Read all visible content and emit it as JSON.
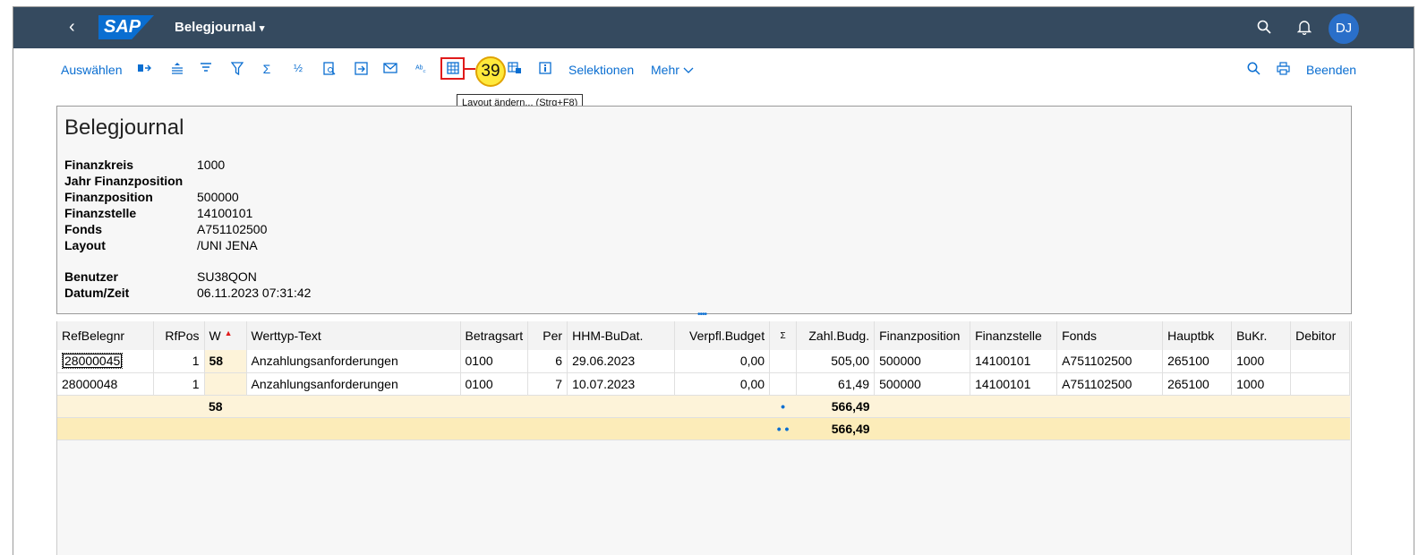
{
  "shell": {
    "title": "Belegjournal",
    "caret": "▾",
    "back_icon": "‹",
    "logo": "SAP",
    "avatar": "DJ"
  },
  "toolbar": {
    "auswaehlen": "Auswählen",
    "selektionen": "Selektionen",
    "mehr": "Mehr",
    "beenden": "Beenden",
    "step_number": "39",
    "tooltip": "Layout ändern... (Strg+F8)"
  },
  "header": {
    "title": "Belegjournal",
    "fields": [
      {
        "label": "Finanzkreis",
        "value": "1000"
      },
      {
        "label": "Jahr Finanzposition",
        "value": ""
      },
      {
        "label": "Finanzposition",
        "value": "500000"
      },
      {
        "label": "Finanzstelle",
        "value": "14100101"
      },
      {
        "label": "Fonds",
        "value": "A751102500"
      },
      {
        "label": "Layout",
        "value": "/UNI JENA"
      }
    ],
    "fields2": [
      {
        "label": "Benutzer",
        "value": "SU38QON"
      },
      {
        "label": "Datum/Zeit",
        "value": "06.11.2023 07:31:42"
      }
    ]
  },
  "grid": {
    "columns": [
      "RefBelegnr",
      "RfPos",
      "W",
      "Werttyp-Text",
      "Betragsart",
      "Per",
      "HHM-BuDat.",
      "Verpfl.Budget",
      "Σ",
      "Zahl.Budg.",
      "Finanzposition",
      "Finanzstelle",
      "Fonds",
      "Hauptbk",
      "BuKr.",
      "Debitor"
    ],
    "rows": [
      [
        "28000045",
        "1",
        "58",
        "Anzahlungsanforderungen",
        "0100",
        "6",
        "29.06.2023",
        "0,00",
        "",
        "505,00",
        "500000",
        "14100101",
        "A751102500",
        "265100",
        "1000",
        ""
      ],
      [
        "28000048",
        "1",
        "",
        "Anzahlungsanforderungen",
        "0100",
        "7",
        "10.07.2023",
        "0,00",
        "",
        "61,49",
        "500000",
        "14100101",
        "A751102500",
        "265100",
        "1000",
        ""
      ]
    ],
    "subtotal": {
      "w": "58",
      "marker": "•",
      "amount": "566,49"
    },
    "total": {
      "marker": "• •",
      "amount": "566,49"
    }
  }
}
